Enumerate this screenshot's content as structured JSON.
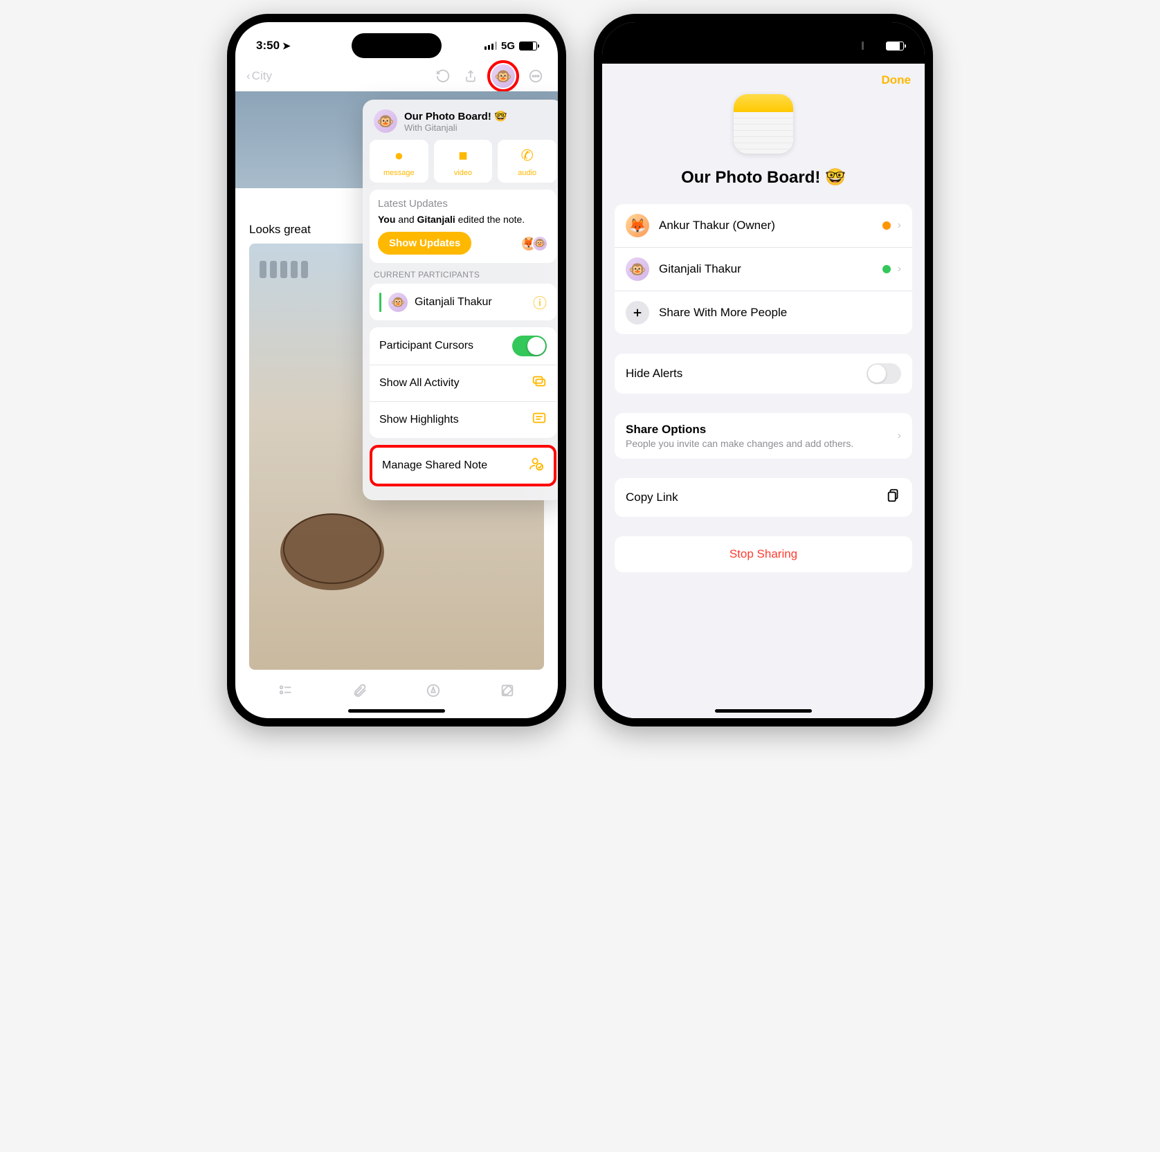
{
  "status": {
    "time": "3:50",
    "network": "5G"
  },
  "phone1": {
    "back_label": "City",
    "caption": "Looks great",
    "popover": {
      "title": "Our Photo Board! 🤓",
      "subtitle": "With Gitanjali",
      "actions": {
        "message": "message",
        "video": "video",
        "audio": "audio"
      },
      "updates_heading": "Latest Updates",
      "updates_text_prefix": "You",
      "updates_text_middle": " and ",
      "updates_text_name": "Gitanjali",
      "updates_text_suffix": " edited the note.",
      "show_updates": "Show Updates",
      "participants_label": "CURRENT PARTICIPANTS",
      "participant_name": "Gitanjali Thakur",
      "cursors_label": "Participant Cursors",
      "activity_label": "Show All Activity",
      "highlights_label": "Show Highlights",
      "manage_label": "Manage Shared Note"
    }
  },
  "phone2": {
    "done": "Done",
    "title": "Our Photo Board! 🤓",
    "people": [
      {
        "name": "Ankur Thakur (Owner)"
      },
      {
        "name": "Gitanjali Thakur"
      }
    ],
    "share_more": "Share With More People",
    "hide_alerts": "Hide Alerts",
    "share_options_title": "Share Options",
    "share_options_desc": "People you invite can make changes and add others.",
    "copy_link": "Copy Link",
    "stop_sharing": "Stop Sharing"
  }
}
